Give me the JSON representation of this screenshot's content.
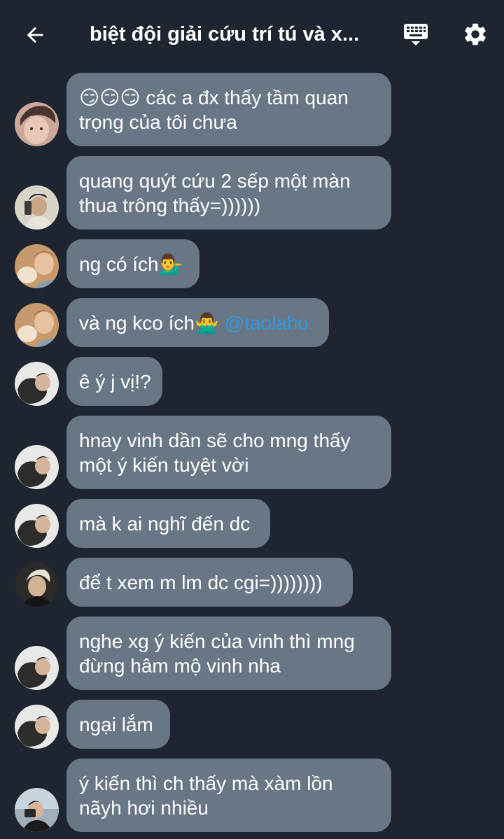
{
  "header": {
    "back_icon": "arrow-left-icon",
    "title": "biệt đội giải cứu trí tú và x...",
    "keyboard_icon": "keyboard-icon",
    "settings_icon": "gear-icon"
  },
  "messages": [
    {
      "avatar": "avatar-1",
      "lines": [
        "😏😏😏 các a đx thấy tầm quan",
        "trọng của tôi chưa"
      ]
    },
    {
      "avatar": "avatar-2",
      "lines": [
        "quang quýt cứu 2 sếp một màn",
        "thua trông thấy=))))))"
      ]
    },
    {
      "avatar": "avatar-3",
      "lines": [
        "ng có ích💁‍♂️"
      ]
    },
    {
      "avatar": "avatar-3",
      "text": "và ng kco ích🙅‍♂️ ",
      "mention": "@taolaho"
    },
    {
      "avatar": "avatar-4",
      "lines": [
        "ê ý j vị!?"
      ]
    },
    {
      "avatar": "avatar-4",
      "lines": [
        "hnay vinh dần sẽ cho mng thấy",
        "một ý kiến tuyệt vời"
      ]
    },
    {
      "avatar": "avatar-4",
      "lines": [
        "mà k ai nghĩ đến dc"
      ]
    },
    {
      "avatar": "avatar-5",
      "lines": [
        "để t xem m lm dc cgi=))))))))"
      ]
    },
    {
      "avatar": "avatar-4",
      "lines": [
        "nghe xg ý kiến của vinh thì mng",
        "đừng hâm mộ vinh nha"
      ]
    },
    {
      "avatar": "avatar-4",
      "lines": [
        "ngại lắm"
      ]
    },
    {
      "avatar": "avatar-6",
      "lines": [
        "ý kiến thì ch thấy mà xàm lồn",
        "nãyh hơi nhiều"
      ]
    }
  ],
  "colors": {
    "background": "#1e2530",
    "bubble": "#687685",
    "mention": "#2f9bdc",
    "text": "#ffffff"
  }
}
